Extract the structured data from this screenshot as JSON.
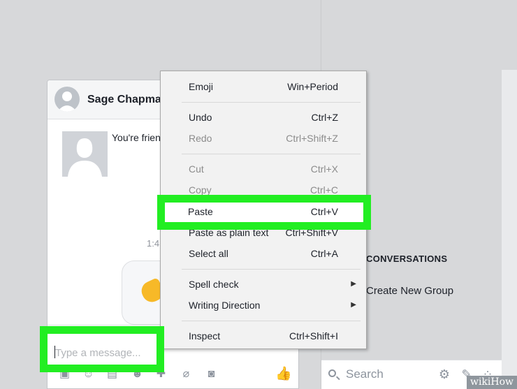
{
  "chat": {
    "contact_name": "Sage Chapma",
    "friends_text": "You're frien",
    "timestamp": "1:4",
    "input_placeholder": "Type a message..."
  },
  "context_menu": {
    "groups": [
      [
        {
          "label": "Emoji",
          "shortcut": "Win+Period",
          "disabled": false
        }
      ],
      [
        {
          "label": "Undo",
          "shortcut": "Ctrl+Z",
          "disabled": false
        },
        {
          "label": "Redo",
          "shortcut": "Ctrl+Shift+Z",
          "disabled": true
        }
      ],
      [
        {
          "label": "Cut",
          "shortcut": "Ctrl+X",
          "disabled": true
        },
        {
          "label": "Copy",
          "shortcut": "Ctrl+C",
          "disabled": true
        },
        {
          "label": "Paste",
          "shortcut": "Ctrl+V",
          "disabled": false,
          "highlighted": true
        },
        {
          "label": "Paste as plain text",
          "shortcut": "Ctrl+Shift+V",
          "disabled": false
        },
        {
          "label": "Select all",
          "shortcut": "Ctrl+A",
          "disabled": false
        }
      ],
      [
        {
          "label": "Spell check",
          "shortcut": "",
          "submenu": true
        },
        {
          "label": "Writing Direction",
          "shortcut": "",
          "submenu": true
        }
      ],
      [
        {
          "label": "Inspect",
          "shortcut": "Ctrl+Shift+I",
          "disabled": false
        }
      ]
    ]
  },
  "sidebar": {
    "conversations_heading": "CONVERSATIONS",
    "create_group": "Create New Group",
    "search_placeholder": "Search"
  },
  "toolbar_icons": [
    "sticker-icon",
    "emoji-icon",
    "gif-icon",
    "smile-icon",
    "game-icon",
    "attach-icon",
    "camera-icon"
  ],
  "watermark": "wikiHow",
  "colors": {
    "highlight": "#22ee22",
    "like_blue": "#1877f2",
    "menu_bg": "#f2f2f2"
  }
}
